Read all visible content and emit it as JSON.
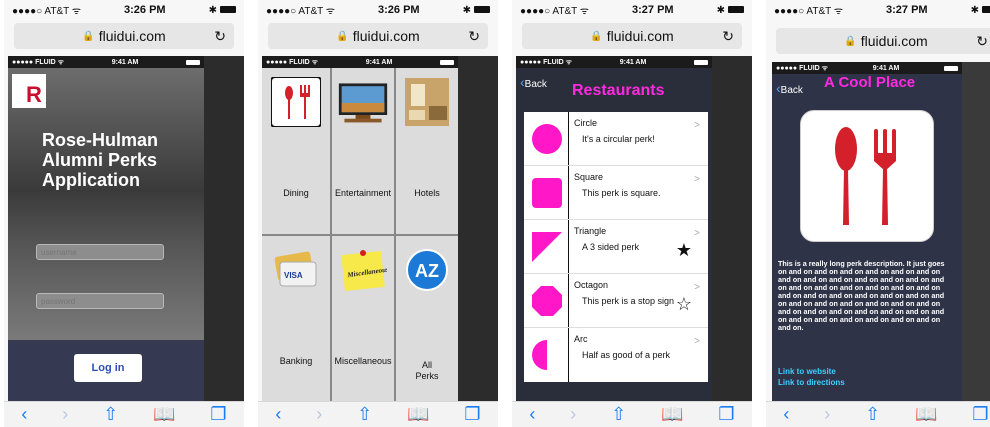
{
  "statusbar": {
    "carrier": "●●●●○ AT&T ᯤ",
    "times": [
      "3:26 PM",
      "3:26 PM",
      "3:27 PM",
      "3:27 PM"
    ],
    "bt": "✱"
  },
  "urlbar": {
    "url": "fluidui.com",
    "lock": "🔒",
    "reload": "↻"
  },
  "inner_status": {
    "carrier": "●●●●● FLUID ᯤ",
    "time": "9:41 AM"
  },
  "toolbar": {
    "back": "‹",
    "forward": "›",
    "share": "⇧",
    "bookmarks": "📖",
    "tabs": "❐"
  },
  "login": {
    "logo_letter": "R",
    "title": "Rose-Hulman Alumni Perks Application",
    "username_placeholder": "username",
    "password_placeholder": "password",
    "login_label": "Log in"
  },
  "categories": [
    "Dining",
    "Entertainment",
    "Hotels",
    "Banking",
    "Miscellaneous",
    "All Perks"
  ],
  "category_images": {
    "misc_note": "Miscellaneous",
    "az_label": "AZ",
    "visa_label": "VISA"
  },
  "restaurants": {
    "back_label": "Back",
    "title": "Restaurants",
    "items": [
      {
        "name": "Circle",
        "desc": "It's a circular perk!",
        "shape": "circle",
        "star": ""
      },
      {
        "name": "Square",
        "desc": "This perk is square.",
        "shape": "square",
        "star": ""
      },
      {
        "name": "Triangle",
        "desc": "A 3 sided perk",
        "shape": "triangle",
        "star": "★"
      },
      {
        "name": "Octagon",
        "desc": "This perk is a stop sign",
        "shape": "octagon",
        "star": "☆"
      },
      {
        "name": "Arc",
        "desc": "Half as good of a perk",
        "shape": "arc",
        "star": ""
      }
    ],
    "arrow": ">"
  },
  "detail": {
    "back_label": "Back",
    "title": "A Cool Place",
    "description": "This is a really long perk description. It just goes on and on and on and on and on and on and on and on and on and on and on and on and on and on and on and on and on and on and on and on and on and on and on and on and on and on and on and on and on and on and on and on and on and on and on and on and on and on and on and on and on and on and on and on and on and on and on.",
    "link_website": "Link to website",
    "link_directions": "Link to directions"
  },
  "colors": {
    "accent_pink": "#ff2ae0",
    "shape_pink": "#ff17c8",
    "link_cyan": "#3ad0ff",
    "ios_blue": "#1a7cf5",
    "dark_panel": "#2a2d3a"
  }
}
